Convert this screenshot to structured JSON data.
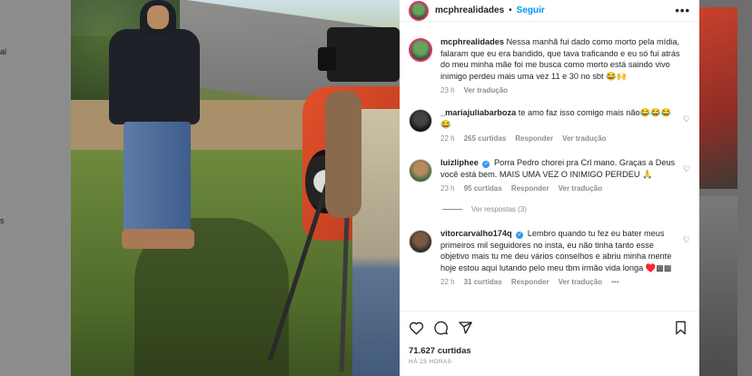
{
  "background": {
    "left_edge_letters": [
      "al",
      "s"
    ]
  },
  "post": {
    "username": "mcphrealidades",
    "follow_label": "Seguir",
    "dot": "•",
    "more_label": "•••",
    "caption": {
      "username": "mcphrealidades",
      "text": "Nessa manhã fui dado como morto pela mídia, falaram que eu era bandido, que tava traficando e eu só fui atrás do meu minha mãe foi me busca como morto está saindo vivo inimigo perdeu mais uma vez 11 e 30 no sbt 😂🙌",
      "time": "23 h",
      "translate": "Ver tradução"
    },
    "comments": [
      {
        "username": "_mariajuliabarboza",
        "text": "te amo faz isso comigo mais não😂😂😂😂",
        "time": "22 h",
        "likes": "265 curtidas",
        "reply": "Responder",
        "translate": "Ver tradução",
        "verified": false
      },
      {
        "username": "luizliphee",
        "text": "Porra Pedro chorei pra Crl mano. Graças a Deus você está bem. MAIS UMA VEZ O INIMIGO PERDEU 🙏",
        "time": "23 h",
        "likes": "95 curtidas",
        "reply": "Responder",
        "translate": "Ver tradução",
        "verified": true
      },
      {
        "username": "vitorcarvalho174q",
        "text": "Lembro quando tu fez eu bater meus primeiros mil seguidores no insta, eu não tinha tanto esse objetivo mais tu me deu vários conselhos e abriu minha mente hoje estou aqui lutando pelo meu tbm irmão vida longa ♥️▩▩",
        "time": "22 h",
        "likes": "31 curtidas",
        "reply": "Responder",
        "translate": "Ver tradução",
        "extra": "•••",
        "verified": true
      }
    ],
    "view_replies": "Ver respostas (3)",
    "likes_total": "71.627 curtidas",
    "posted_ago": "HÁ 23 HORAS"
  },
  "icons": {
    "like": "heart-icon",
    "comment": "comment-icon",
    "share": "share-icon",
    "save": "bookmark-icon",
    "more": "more-icon",
    "verified": "verified-badge-icon"
  }
}
